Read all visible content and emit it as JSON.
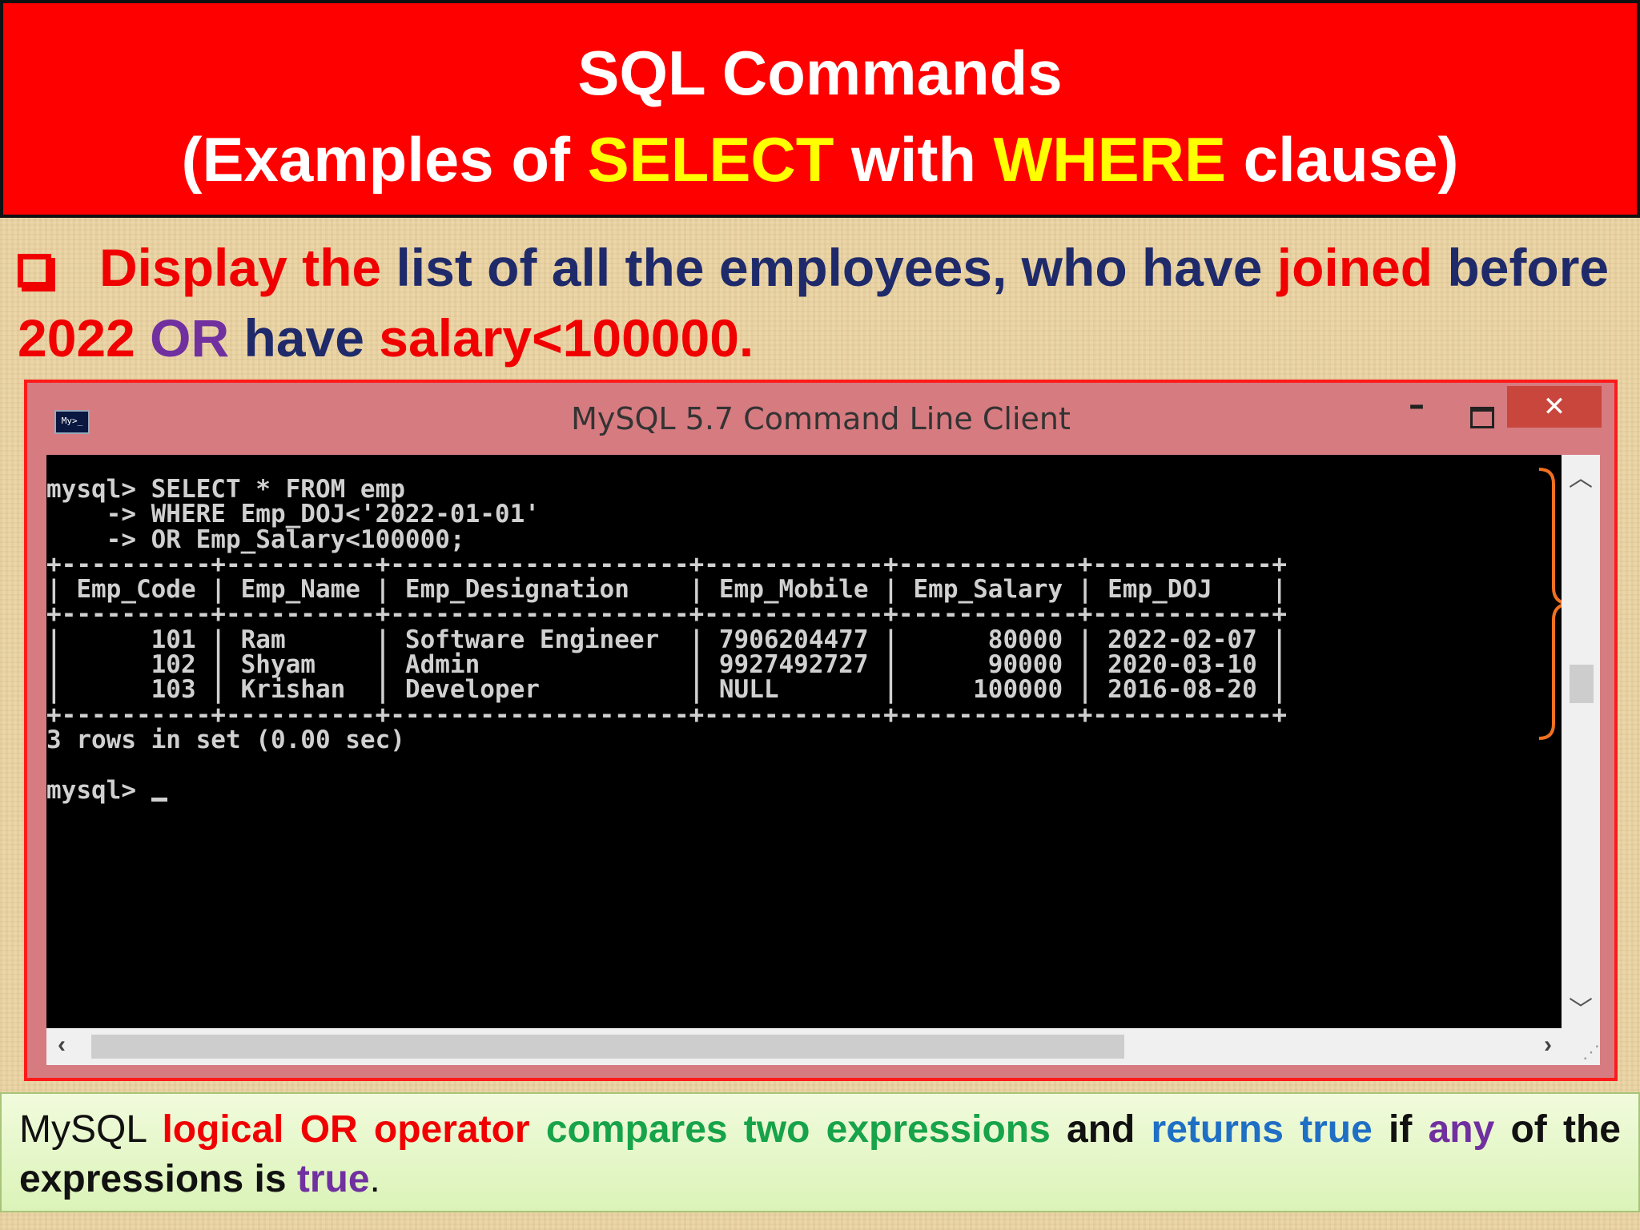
{
  "slide": {
    "title_line1": "SQL Commands",
    "title_line2": {
      "prefix": "(Examples of ",
      "kw1": "SELECT",
      "middle": " with ",
      "kw2": "WHERE",
      "suffix": " clause)"
    },
    "task": {
      "t1": "Display the",
      "t2": " list of all the employees, who have ",
      "t3": "joined",
      "t4": " before",
      "t5": "2022",
      "t6": " OR",
      "t7": " have ",
      "t8": "salary<100000."
    }
  },
  "window": {
    "title": "MySQL 5.7 Command Line Client",
    "icon_label": "My>_",
    "minimize_label": "–",
    "close_label": "✕"
  },
  "console": {
    "lines": [
      "mysql> SELECT * FROM emp",
      "    -> WHERE Emp_DOJ<'2022-01-01'",
      "    -> OR Emp_Salary<100000;",
      "+----------+----------+--------------------+------------+------------+------------+",
      "| Emp_Code | Emp_Name | Emp_Designation    | Emp_Mobile | Emp_Salary | Emp_DOJ    |",
      "+----------+----------+--------------------+------------+------------+------------+",
      "|      101 | Ram      | Software Engineer  | 7906204477 |      80000 | 2022-02-07 |",
      "|      102 | Shyam    | Admin              | 9927492727 |      90000 | 2020-03-10 |",
      "|      103 | Krishan  | Developer          | NULL       |     100000 | 2016-08-20 |",
      "+----------+----------+--------------------+------------+------------+------------+",
      "3 rows in set (0.00 sec)",
      "",
      "mysql> "
    ]
  },
  "note": {
    "w1": "MySQL",
    "w2": "logical",
    "w3": "OR",
    "w4": "operator",
    "w5": "compares",
    "w6": "two",
    "w7": "expressions",
    "w8": "and",
    "w9": "returns",
    "w10": "true",
    "w11": "if",
    "w12": "any",
    "w13": "of",
    "w14": "the",
    "l2a": "expressions is ",
    "l2b": "true",
    "l2c": "."
  },
  "colors": {
    "banner": "#fe0000",
    "highlight": "#ffff00",
    "brace": "#f07020"
  }
}
